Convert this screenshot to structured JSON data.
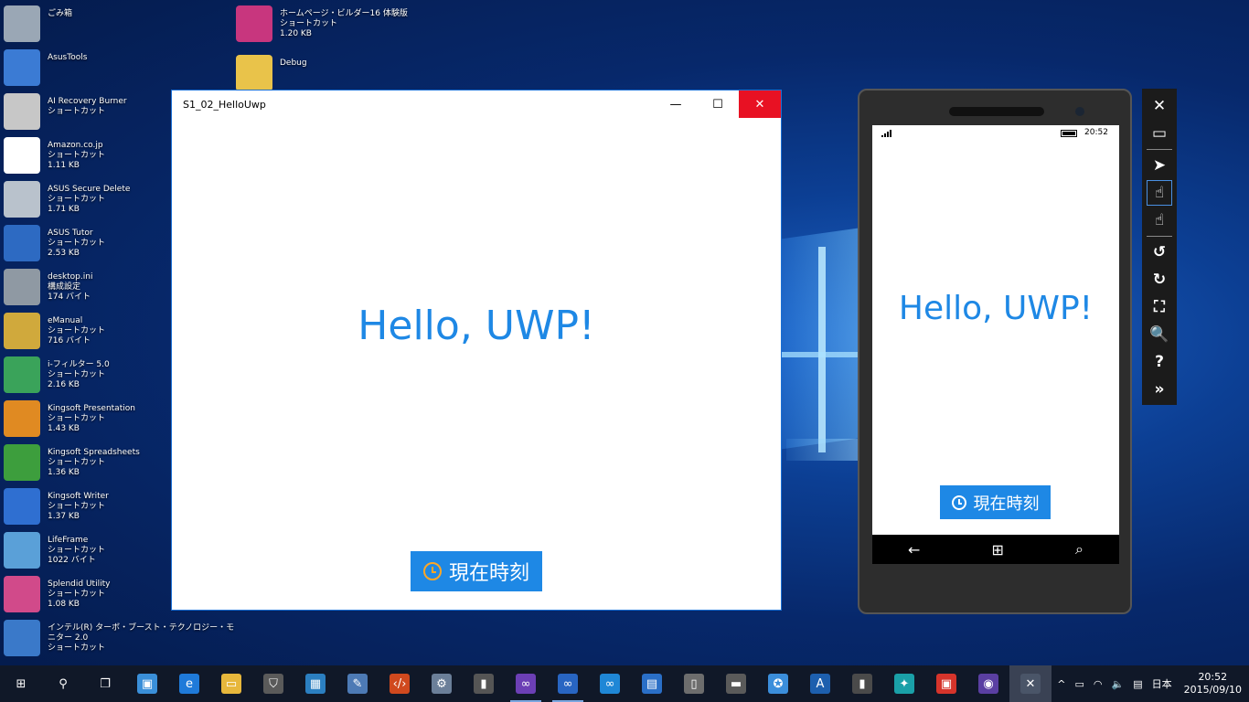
{
  "desktop": {
    "icons": [
      {
        "label": "ごみ箱",
        "line2": "",
        "line3": "",
        "color": "#9aa7b5"
      },
      {
        "label": "AsusTools",
        "line2": "",
        "line3": "",
        "color": "#3b7bd4"
      },
      {
        "label": "AI Recovery Burner",
        "line2": "ショートカット",
        "line3": "",
        "color": "#c7c7c7"
      },
      {
        "label": "Amazon.co.jp",
        "line2": "ショートカット",
        "line3": "1.11 KB",
        "color": "#ffffff"
      },
      {
        "label": "ASUS Secure Delete",
        "line2": "ショートカット",
        "line3": "1.71 KB",
        "color": "#b9c2cc"
      },
      {
        "label": "ASUS Tutor",
        "line2": "ショートカット",
        "line3": "2.53 KB",
        "color": "#2d6ac2"
      },
      {
        "label": "desktop.ini",
        "line2": "構成設定",
        "line3": "174 バイト",
        "color": "#8f99a3"
      },
      {
        "label": "eManual",
        "line2": "ショートカット",
        "line3": "716 バイト",
        "color": "#d0a93c"
      },
      {
        "label": "i-フィルター 5.0",
        "line2": "ショートカット",
        "line3": "2.16 KB",
        "color": "#3aa35a"
      },
      {
        "label": "Kingsoft Presentation",
        "line2": "ショートカット",
        "line3": "1.43 KB",
        "color": "#e08a22"
      },
      {
        "label": "Kingsoft Spreadsheets",
        "line2": "ショートカット",
        "line3": "1.36 KB",
        "color": "#3d9e3d"
      },
      {
        "label": "Kingsoft Writer",
        "line2": "ショートカット",
        "line3": "1.37 KB",
        "color": "#2f6fd1"
      },
      {
        "label": "LifeFrame",
        "line2": "ショートカット",
        "line3": "1022 バイト",
        "color": "#5aa0d8"
      },
      {
        "label": "Splendid Utility",
        "line2": "ショートカット",
        "line3": "1.08 KB",
        "color": "#d14a8a"
      },
      {
        "label": "インテル(R) ターボ・ブースト・テクノロジー・モ",
        "line2": "ニター 2.0",
        "line3": "ショートカット",
        "color": "#3a79c9"
      }
    ],
    "icons_col2": [
      {
        "label": "ホームページ・ビルダー16 体験版",
        "line2": "ショートカット",
        "line3": "1.20 KB",
        "color": "#c8367e"
      },
      {
        "label": "Debug",
        "line2": "",
        "line3": "",
        "color": "#e9c34a"
      }
    ]
  },
  "app_window": {
    "title": "S1_02_HelloUwp",
    "minimize": "—",
    "maximize": "☐",
    "close": "✕",
    "heading": "Hello, UWP!",
    "button_label": "現在時刻"
  },
  "phone": {
    "clock": "20:52",
    "heading": "Hello, UWP!",
    "button_label": "現在時刻",
    "nav_back": "←",
    "nav_start": "⊞",
    "nav_search": "⌕"
  },
  "emulator_toolbar": {
    "close": "✕",
    "minimize": "▭",
    "pointer": "➤",
    "touch": "☝",
    "multi_touch": "☝",
    "rotate_left": "↺",
    "rotate_right": "↻",
    "fit": "⛶",
    "zoom": "🔍",
    "help": "?",
    "tools": "»"
  },
  "taskbar": {
    "items": [
      {
        "name": "start",
        "glyph": "⊞",
        "color": "transparent",
        "state": ""
      },
      {
        "name": "search",
        "glyph": "⚲",
        "color": "transparent",
        "state": ""
      },
      {
        "name": "task-view",
        "glyph": "❐",
        "color": "transparent",
        "state": ""
      },
      {
        "name": "app-1",
        "glyph": "▣",
        "color": "#3a8fd9",
        "state": ""
      },
      {
        "name": "edge",
        "glyph": "e",
        "color": "#1f7ad9",
        "state": ""
      },
      {
        "name": "explorer",
        "glyph": "▭",
        "color": "#e7b73c",
        "state": ""
      },
      {
        "name": "store",
        "glyph": "⛉",
        "color": "#5a5a5a",
        "state": ""
      },
      {
        "name": "app-2",
        "glyph": "▦",
        "color": "#2b7fc1",
        "state": ""
      },
      {
        "name": "app-3",
        "glyph": "✎",
        "color": "#4d7ab5",
        "state": ""
      },
      {
        "name": "app-4",
        "glyph": "‹/›",
        "color": "#d0491e",
        "state": ""
      },
      {
        "name": "app-5",
        "glyph": "⚙",
        "color": "#6b7f99",
        "state": ""
      },
      {
        "name": "app-6",
        "glyph": "▮",
        "color": "#555555",
        "state": ""
      },
      {
        "name": "visual-studio",
        "glyph": "∞",
        "color": "#6c3fb5",
        "state": "running"
      },
      {
        "name": "visual-studio-2",
        "glyph": "∞",
        "color": "#2865c2",
        "state": "running"
      },
      {
        "name": "vs-code",
        "glyph": "∞",
        "color": "#1f87d6",
        "state": ""
      },
      {
        "name": "app-7",
        "glyph": "▤",
        "color": "#2a6fc7",
        "state": ""
      },
      {
        "name": "app-8",
        "glyph": "▯",
        "color": "#6d6d6d",
        "state": ""
      },
      {
        "name": "app-9",
        "glyph": "▬",
        "color": "#5a5a5a",
        "state": ""
      },
      {
        "name": "app-10",
        "glyph": "✪",
        "color": "#3b8edb",
        "state": ""
      },
      {
        "name": "app-11",
        "glyph": "A",
        "color": "#1d5fae",
        "state": ""
      },
      {
        "name": "app-12",
        "glyph": "▮",
        "color": "#4a4a4a",
        "state": ""
      },
      {
        "name": "app-13",
        "glyph": "✦",
        "color": "#1aa0a8",
        "state": ""
      },
      {
        "name": "app-14",
        "glyph": "▣",
        "color": "#d6342b",
        "state": ""
      },
      {
        "name": "app-15",
        "glyph": "◉",
        "color": "#5a3fa2",
        "state": ""
      },
      {
        "name": "app-16",
        "glyph": "✕",
        "color": "#4a5568",
        "state": "active"
      }
    ],
    "tray": {
      "chevron": "^",
      "battery": "▭",
      "wifi": "◠",
      "volume": "🔈",
      "notification": "▤",
      "ime": "日本",
      "time": "20:52",
      "date": "2015/09/10"
    }
  }
}
